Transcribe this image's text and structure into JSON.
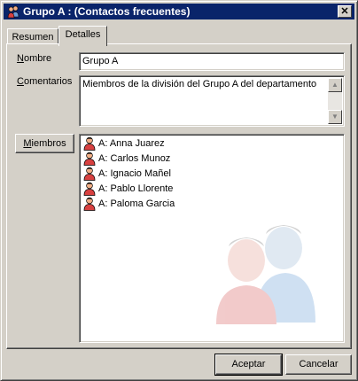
{
  "window": {
    "title": "Grupo A :  (Contactos frecuentes)",
    "close_glyph": "✕"
  },
  "tabs": [
    {
      "label": "Resumen",
      "selected": false
    },
    {
      "label": "Detalles",
      "selected": true
    }
  ],
  "form": {
    "name_label": {
      "pre": "",
      "key": "N",
      "post": "ombre"
    },
    "name_value": "Grupo A",
    "comments_label": {
      "pre": "",
      "key": "C",
      "post": "omentarios"
    },
    "comments_value": "Miembros de la división del Grupo A del departamento",
    "members_button": {
      "pre": "",
      "key": "M",
      "post": "iembros"
    }
  },
  "members": [
    {
      "label": "A: Anna Juarez",
      "icon": "person-icon"
    },
    {
      "label": "A: Carlos Munoz",
      "icon": "person-icon"
    },
    {
      "label": "A: Ignacio Mañel",
      "icon": "person-icon"
    },
    {
      "label": "A: Pablo Llorente",
      "icon": "person-icon"
    },
    {
      "label": "A: Paloma Garcia",
      "icon": "person-icon"
    }
  ],
  "footer": {
    "ok_label": "Aceptar",
    "cancel_label": "Cancelar"
  },
  "colors": {
    "titlebar": "#0a246a",
    "face": "#d4d0c8",
    "person_red": "#d84040",
    "person_skin": "#f2b088",
    "watermark_red": "#e8a0a0",
    "watermark_blue": "#a8c8e8"
  }
}
